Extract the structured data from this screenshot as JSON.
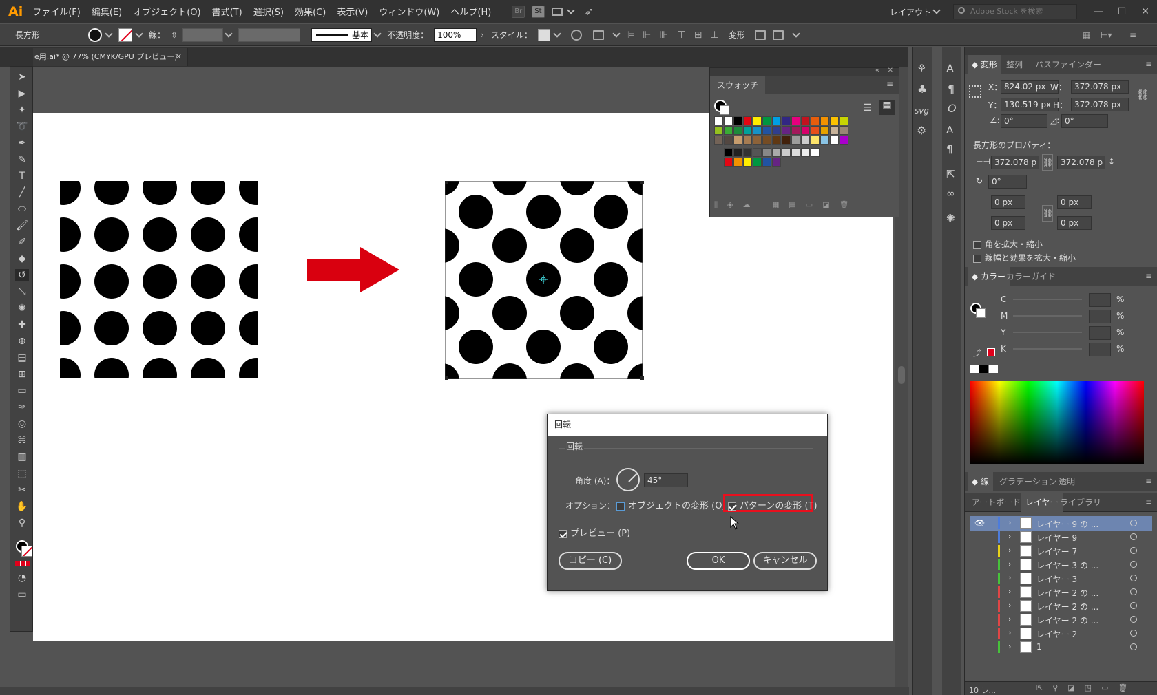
{
  "app": {
    "logo": "Ai"
  },
  "menu": [
    "ファイル(F)",
    "編集(E)",
    "オブジェクト(O)",
    "書式(T)",
    "選択(S)",
    "効果(C)",
    "表示(V)",
    "ウィンドウ(W)",
    "ヘルプ(H)"
  ],
  "menubar_buttons": {
    "br": "Br",
    "st": "St"
  },
  "workspace": "レイアウト",
  "search_placeholder": "Adobe Stock を検索",
  "control": {
    "selection": "長方形",
    "stroke_label": "線：",
    "brush": "基本",
    "opacity_label": "不透明度：",
    "opacity": "100%",
    "style_label": "スタイル：",
    "transform_label": "変形"
  },
  "document_tab": "e用.ai* @ 77% (CMYK/GPU プレビュー)",
  "swatches_panel": {
    "title": "スウォッチ"
  },
  "transform_panel": {
    "tabs": [
      "変形",
      "整列",
      "パスファインダー"
    ],
    "x_label": "X：",
    "x": "824.02 px",
    "w_label": "W：",
    "w": "372.078 px",
    "y_label": "Y：",
    "y": "130.519 px",
    "h_label": "H：",
    "h": "372.078 px",
    "angle": "0°",
    "shear": "0°",
    "rect_props": "長方形のプロパティ：",
    "rw": "372.078 p",
    "rh": "372.078 p",
    "rot": "0°",
    "r1": "0 px",
    "r2": "0 px",
    "r3": "0 px",
    "r4": "0 px",
    "scale_corners": "角を拡大・縮小",
    "scale_strokes": "線幅と効果を拡大・縮小"
  },
  "color_panel": {
    "tabs": [
      "カラー",
      "カラーガイド"
    ],
    "channels": [
      "C",
      "M",
      "Y",
      "K"
    ],
    "unit": "%"
  },
  "stroke_tabs": [
    "線",
    "グラデーション",
    "透明"
  ],
  "layers_panel": {
    "tabs": [
      "アートボード",
      "レイヤー",
      "ライブラリ"
    ],
    "layers": [
      {
        "name": "レイヤー 9 の ...",
        "color": "#4d7cdb"
      },
      {
        "name": "レイヤー 9",
        "color": "#4d7cdb"
      },
      {
        "name": "レイヤー 7",
        "color": "#e8d21a"
      },
      {
        "name": "レイヤー 3 の ...",
        "color": "#47c23b"
      },
      {
        "name": "レイヤー 3",
        "color": "#47c23b"
      },
      {
        "name": "レイヤー 2 の ...",
        "color": "#e04646"
      },
      {
        "name": "レイヤー 2 の ...",
        "color": "#e04646"
      },
      {
        "name": "レイヤー 2 の ...",
        "color": "#e04646"
      },
      {
        "name": "レイヤー 2",
        "color": "#e04646"
      },
      {
        "name": "1",
        "color": "#47c23b"
      }
    ],
    "footer": "10 レ..."
  },
  "dialog": {
    "title": "回転",
    "group": "回転",
    "angle_label": "角度 (A)：",
    "angle": "45°",
    "options_label": "オプション：",
    "transform_objects": "オブジェクトの変形 (O)",
    "transform_patterns": "パターンの変形 (T)",
    "preview": "プレビュー (P)",
    "copy": "コピー (C)",
    "ok": "OK",
    "cancel": "キャンセル"
  },
  "colors": {
    "accent_red": "#e0001b",
    "arrow_red": "#d9000f",
    "highlight_border": "#e8101e",
    "selection_blue": "#6d85b0"
  }
}
